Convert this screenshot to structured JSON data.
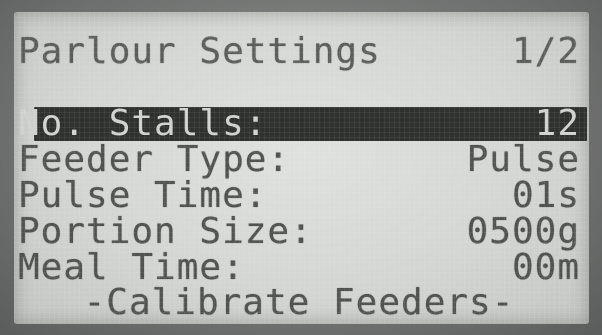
{
  "screen": {
    "title": "Parlour Settings",
    "page_indicator": "1/2"
  },
  "settings": [
    {
      "label": "No. Stalls:",
      "value": "12",
      "selected": true
    },
    {
      "label": "Feeder Type:",
      "value": "Pulse"
    },
    {
      "label": "Pulse Time:",
      "value": "01s"
    },
    {
      "label": "Portion Size:",
      "value": "0500g"
    },
    {
      "label": "Meal Time:",
      "value": "00m"
    }
  ],
  "action": {
    "label": "-Calibrate Feeders-"
  }
}
